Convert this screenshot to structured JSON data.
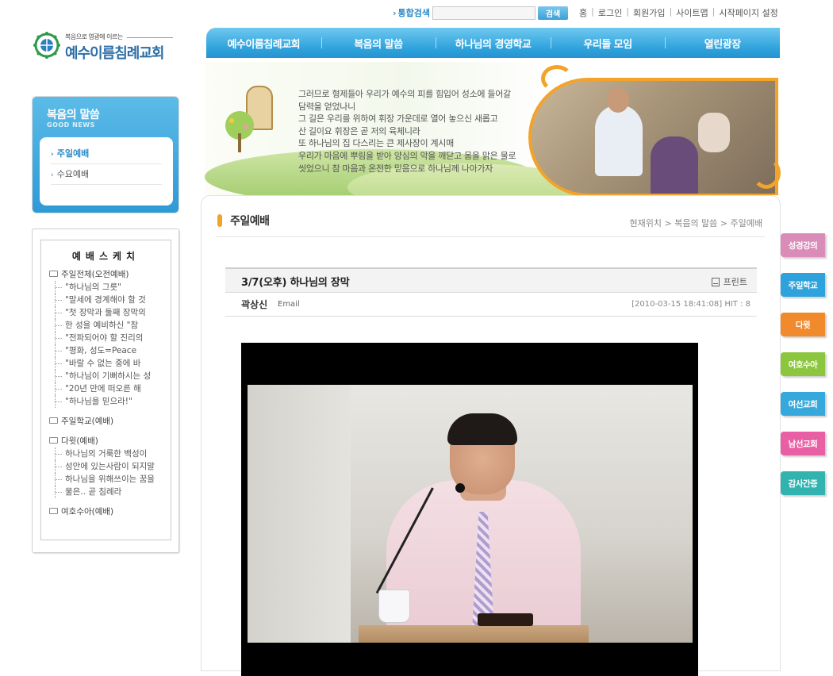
{
  "topbar": {
    "search_label": "통합검색",
    "search_placeholder": "",
    "search_button": "검색",
    "links": [
      "홈",
      "로그인",
      "회원가입",
      "사이트맵",
      "시작페이지 설정"
    ]
  },
  "logo": {
    "tagline": "복음으로 영광에 이르는",
    "name": "예수이름침례교회"
  },
  "nav": {
    "items": [
      "예수이름침례교회",
      "복음의 말씀",
      "하나님의 경영학교",
      "우리들 모임",
      "열린광장"
    ]
  },
  "banner": {
    "lines": [
      "그러므로 형제들아 우리가 예수의 피를 힘입어 성소에 들어갈",
      "담력을 얻었나니",
      "그 길은 우리를 위하여 휘장 가운데로 열어 놓으신 새롭고",
      "산 길이요 휘장은 곧 저의 육체니라",
      "또 하나님의 집 다스리는 큰 제사장이 계시매",
      "우리가 마음에 뿌림을 받아 양심의 악을 깨닫고 몸을 맑은 물로",
      "씻었으니 참 마음과 온전한 믿음으로 하나님께 나아가자"
    ]
  },
  "submenu": {
    "title": "복음의 말씀",
    "subtitle": "GOOD NEWS",
    "items": [
      {
        "label": "주일예배",
        "active": true
      },
      {
        "label": "수요예배",
        "active": false
      }
    ]
  },
  "sketch": {
    "title": "예배스케치",
    "folders": [
      {
        "label": "주일전체(오전예배)",
        "children": [
          "\"하나님의 그릇\"",
          "\"말세에 경계해야 할 것",
          "\"첫 장막과 둘째 장막의",
          "한 성을 예비하신 \"참",
          "\"전파되어야 할 진리의",
          "\"평화, 성도=Peace",
          "\"바랄 수 없는 중에 바",
          "\"하나님이 기뻐하시는 성",
          "\"20년 만에 떠오른 해",
          "\"하나님을 믿으라!\""
        ]
      },
      {
        "label": "주일학교(예배)",
        "children": []
      },
      {
        "label": "다윗(예배)",
        "children": [
          "하나님의 거룩한 백성이",
          "성안에 있는사람이 되지말",
          "하나님을 위해쓰이는 꿈을",
          "물은.. 곧 침례라"
        ]
      },
      {
        "label": "여호수아(예배)",
        "children": []
      }
    ]
  },
  "content": {
    "page_title": "주일예배",
    "breadcrumb": "현재위치 > 복음의 말씀 > 주일예배",
    "post": {
      "title": "3/7(오후) 하나님의 장막",
      "print_label": "프린트",
      "author": "곽상신",
      "email_label": "Email",
      "date_hits": "[2010-03-15 18:41:08]  HIT : 8"
    }
  },
  "sidetabs": [
    {
      "label": "성경강의",
      "color": "#d98cb8"
    },
    {
      "label": "주일학교",
      "color": "#2ea2dc"
    },
    {
      "label": "다윗",
      "color": "#f08a2c"
    },
    {
      "label": "여호수아",
      "color": "#8cc63f"
    },
    {
      "label": "여선교회",
      "color": "#37a8dc"
    },
    {
      "label": "남선교회",
      "color": "#e95fa3"
    },
    {
      "label": "감사간증",
      "color": "#33b3b0"
    }
  ]
}
